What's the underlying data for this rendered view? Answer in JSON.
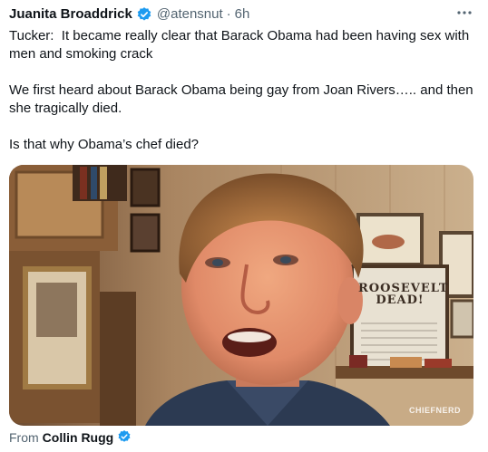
{
  "tweet": {
    "author_name": "Juanita Broaddrick",
    "handle": "@atensnut",
    "separator": "·",
    "time": "6h",
    "paragraphs": [
      "Tucker:  It became really clear that Barack Obama had been having sex with men and smoking crack",
      "We first heard about Barack Obama being gay from Joan Rivers….. and then she tragically died.",
      "Is that why Obama’s chef died?"
    ],
    "more_icon": "more-horizontal-icon",
    "verified_icon": "verified-badge-icon"
  },
  "media": {
    "poster_line1": "ROOSEVELT",
    "poster_line2": "DEAD!",
    "watermark": "CHIEFNERD"
  },
  "attribution": {
    "prefix": "From",
    "name": "Collin Rugg"
  },
  "colors": {
    "verified_blue": "#1d9bf0",
    "secondary_text": "#536471",
    "primary_text": "#0f1419"
  }
}
